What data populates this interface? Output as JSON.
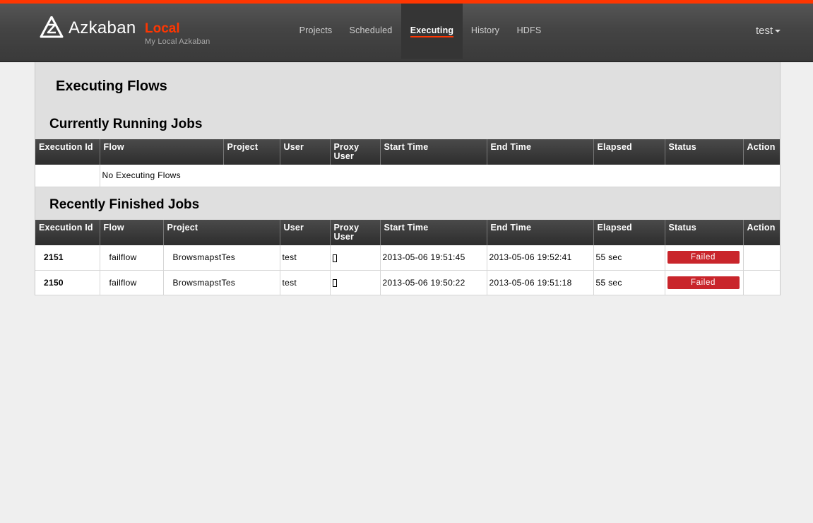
{
  "header": {
    "brand_name": "Azkaban",
    "brand_env": "Local",
    "brand_subtitle": "My Local Azkaban",
    "nav": [
      {
        "label": "Projects"
      },
      {
        "label": "Scheduled"
      },
      {
        "label": "Executing",
        "active": true
      },
      {
        "label": "History"
      },
      {
        "label": "HDFS"
      }
    ],
    "user": "test"
  },
  "page": {
    "title": "Executing Flows"
  },
  "running": {
    "title": "Currently Running Jobs",
    "columns": [
      "Execution Id",
      "Flow",
      "Project",
      "User",
      "Proxy User",
      "Start Time",
      "End Time",
      "Elapsed",
      "Status",
      "Action"
    ],
    "empty_message": "No Executing Flows"
  },
  "finished": {
    "title": "Recently Finished Jobs",
    "columns": [
      "Execution Id",
      "Flow",
      "Project",
      "User",
      "Proxy User",
      "Start Time",
      "End Time",
      "Elapsed",
      "Status",
      "Action"
    ],
    "rows": [
      {
        "id": "2151",
        "flow": "failflow",
        "project": "BrowsmapstTes",
        "user": "test",
        "proxy": "",
        "start": "2013-05-06 19:51:45",
        "end": "2013-05-06 19:52:41",
        "elapsed": "55 sec",
        "status": "Failed",
        "action": ""
      },
      {
        "id": "2150",
        "flow": "failflow",
        "project": "BrowsmapstTes",
        "user": "test",
        "proxy": "",
        "start": "2013-05-06 19:50:22",
        "end": "2013-05-06 19:51:18",
        "elapsed": "55 sec",
        "status": "Failed",
        "action": ""
      }
    ]
  },
  "colors": {
    "accent": "#ff3601",
    "failed": "#c9252b",
    "header_bg": "#444444"
  }
}
